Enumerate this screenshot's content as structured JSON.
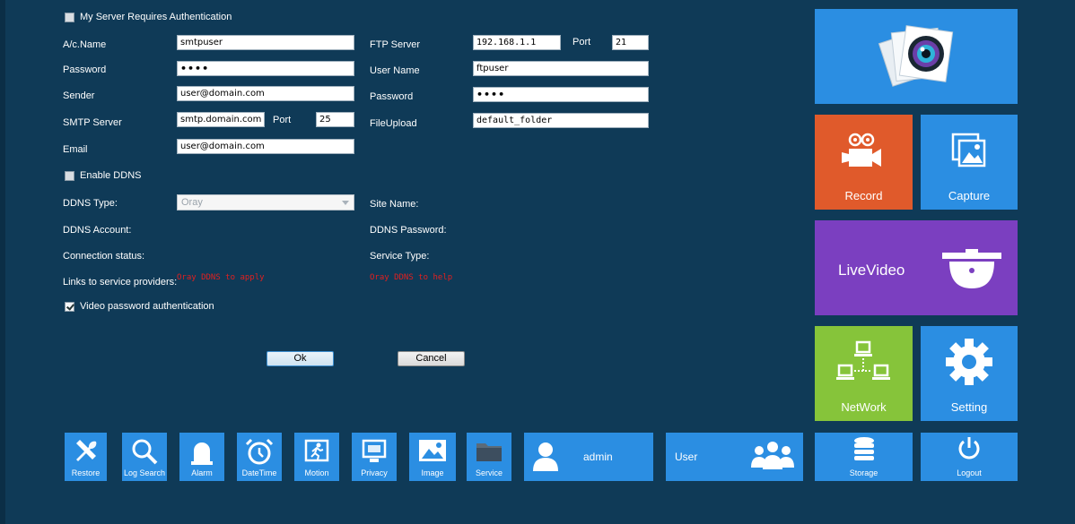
{
  "smtp": {
    "auth_label": "My Server Requires Authentication",
    "account_label": "A/c.Name",
    "account_value": "smtpuser",
    "password_label": "Password",
    "password_value": "••••",
    "sender_label": "Sender",
    "sender_value": "user@domain.com",
    "server_label": "SMTP Server",
    "server_value": "smtp.domain.com",
    "port_label": "Port",
    "port_value": "25",
    "email_label": "Email",
    "email_value": "user@domain.com"
  },
  "ftp": {
    "server_label": "FTP Server",
    "server_value": "192.168.1.1",
    "port_label": "Port",
    "port_value": "21",
    "username_label": "User Name",
    "username_value": "ftpuser",
    "password_label": "Password",
    "password_value": "••••",
    "upload_label": "FileUpload",
    "upload_value": "default_folder"
  },
  "ddns": {
    "enable_label": "Enable DDNS",
    "type_label": "DDNS Type:",
    "type_value": "Oray",
    "site_label": "Site Name:",
    "account_label": "DDNS Account:",
    "password_label": "DDNS Password:",
    "status_label": "Connection status:",
    "service_label": "Service Type:",
    "links_label": "Links to service providers:",
    "apply_link": "Oray DDNS to apply",
    "help_link": "Oray DDNS to help"
  },
  "video_auth_label": "Video password authentication",
  "buttons": {
    "ok": "Ok",
    "cancel": "Cancel"
  },
  "tiles": {
    "record": "Record",
    "capture": "Capture",
    "livevideo": "LiveVideo",
    "network": "NetWork",
    "setting": "Setting",
    "storage": "Storage",
    "logout": "Logout"
  },
  "bottom_bar": [
    {
      "label": "Restore",
      "icon": "tools-icon"
    },
    {
      "label": "Log Search",
      "icon": "search-icon"
    },
    {
      "label": "Alarm",
      "icon": "alarm-icon"
    },
    {
      "label": "DateTime",
      "icon": "clock-icon"
    },
    {
      "label": "Motion",
      "icon": "motion-icon"
    },
    {
      "label": "Privacy",
      "icon": "privacy-icon"
    },
    {
      "label": "Image",
      "icon": "image-icon"
    },
    {
      "label": "Service",
      "icon": "folder-icon"
    }
  ],
  "user_panel": {
    "admin_label": "admin",
    "user_label": "User"
  },
  "colors": {
    "background": "#0f3a57",
    "tile_blue": "#2b8ee2",
    "record_orange": "#e05a2b",
    "live_purple": "#7b3fc0",
    "network_green": "#86c43a",
    "link_red": "#e02020"
  }
}
